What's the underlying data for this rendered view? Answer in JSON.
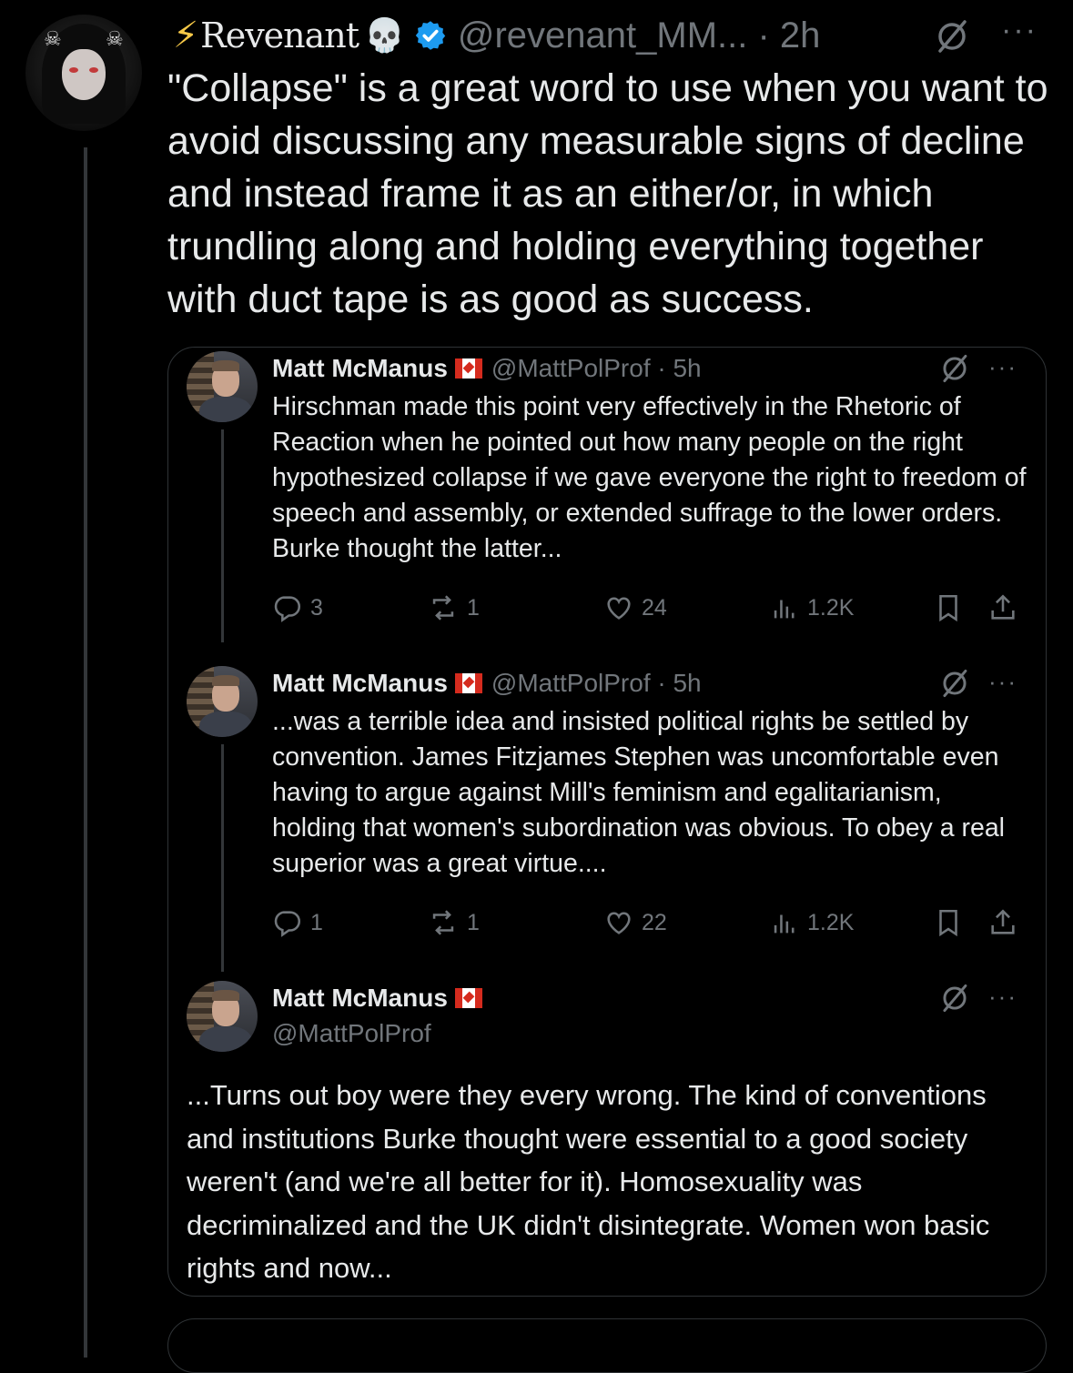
{
  "main_post": {
    "display_name": "Revenant",
    "bolt_emoji": "⚡",
    "skull_emoji": "💀",
    "handle_time": "@revenant_MM... · 2h",
    "text": "\"Collapse\" is a great word to use when you want to avoid discussing any measurable signs of decline and instead frame it as an either/or, in which trundling along and holding everything together with duct tape is as good as success.",
    "more": "···"
  },
  "quoted_thread": [
    {
      "name": "Matt McManus",
      "handle_time": "@MattPolProf · 5h",
      "more": "···",
      "text": "Hirschman made this point very effectively in the Rhetoric of Reaction when he pointed out how many people on the right hypothesized collapse if we gave everyone the right to freedom of speech and assembly, or extended suffrage to the lower orders. Burke thought the latter...",
      "replies": "3",
      "reposts": "1",
      "likes": "24",
      "views": "1.2K"
    },
    {
      "name": "Matt McManus",
      "handle_time": "@MattPolProf · 5h",
      "more": "···",
      "text": "...was a terrible idea and insisted political rights be settled by convention. James Fitzjames Stephen was uncomfortable even having to argue against Mill's feminism and egalitarianism, holding that women's subordination was obvious. To obey a real superior was a great virtue....",
      "replies": "1",
      "reposts": "1",
      "likes": "22",
      "views": "1.2K"
    },
    {
      "name": "Matt McManus",
      "handle": "@MattPolProf",
      "more": "···",
      "text": "...Turns out boy were they every wrong. The kind of conventions and institutions Burke thought were essential to a good society weren't (and we're all better for it). Homosexuality was decriminalized and the UK didn't disintegrate. Women won basic rights and now..."
    }
  ],
  "colors": {
    "background": "#000000",
    "text": "#e7e9ea",
    "muted": "#71767b",
    "border": "#2f3336",
    "verified": "#1d9bf0"
  }
}
